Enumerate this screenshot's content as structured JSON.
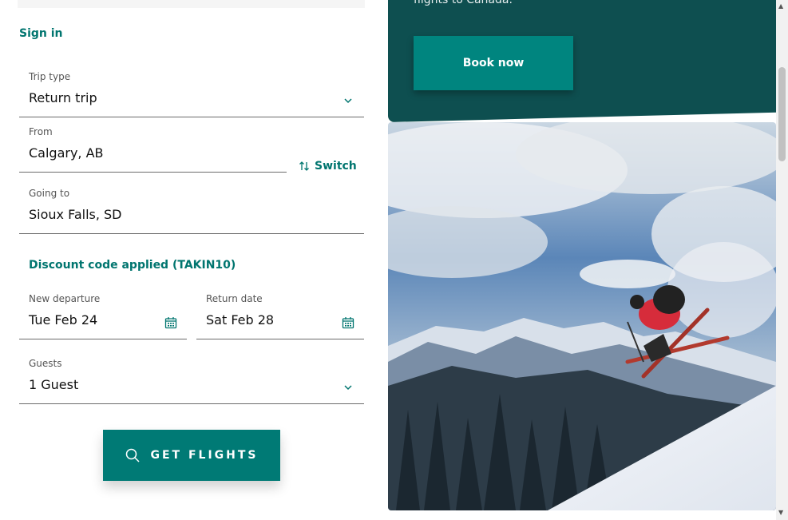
{
  "sign_in": "Sign in",
  "trip_type": {
    "label": "Trip type",
    "value": "Return trip"
  },
  "from": {
    "label": "From",
    "value": "Calgary, AB"
  },
  "switch_label": "Switch",
  "going_to": {
    "label": "Going to",
    "value": "Sioux Falls, SD"
  },
  "discount": "Discount code applied (TAKIN10)",
  "departure": {
    "label": "New departure",
    "value": "Tue Feb 24"
  },
  "return_date": {
    "label": "Return date",
    "value": "Sat Feb 28"
  },
  "guests": {
    "label": "Guests",
    "value": "1 Guest"
  },
  "get_flights": "GET FLIGHTS",
  "promo": {
    "text": "flights to Canada.",
    "button": "Book now"
  },
  "colors": {
    "accent": "#00756f",
    "promo_bg": "#0e4f50",
    "button_bg": "#007a75"
  }
}
